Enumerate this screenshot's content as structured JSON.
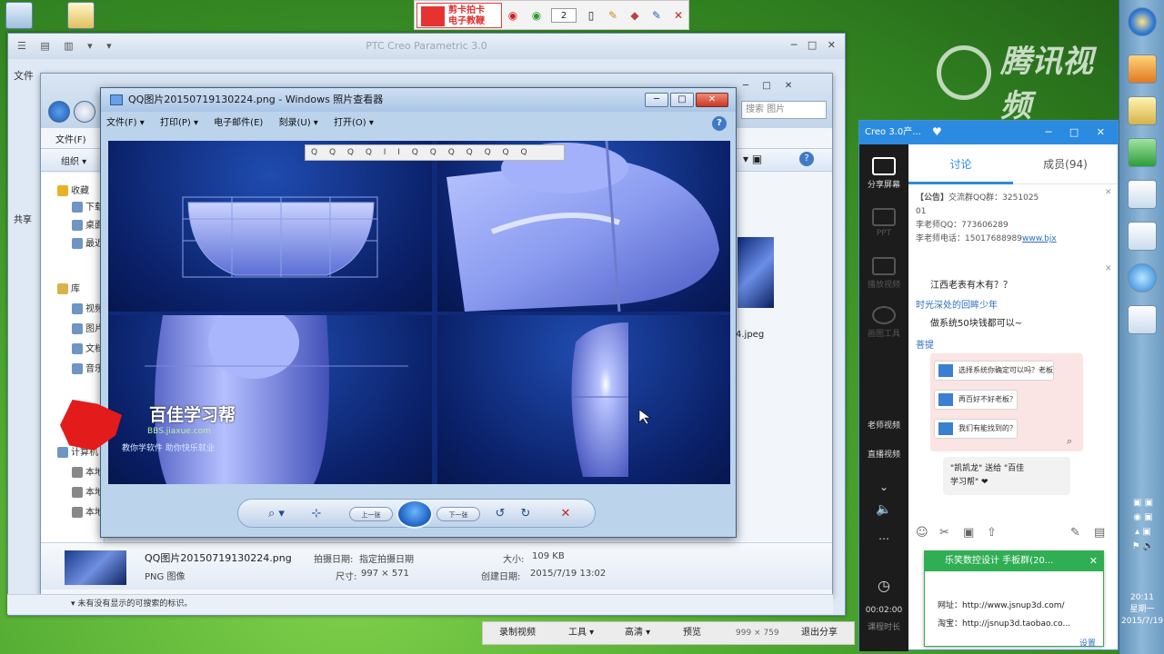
{
  "recorder": {
    "logo_line1": "剪卡拍卡",
    "logo_line2": "电子教鞭",
    "counter": "2",
    "bottom": {
      "record": "录制视频",
      "tools": "工具 ▾",
      "quality": "高清 ▾",
      "preview": "预览",
      "resolution": "999 × 759",
      "exit": "退出分享"
    }
  },
  "watermark": "腾讯视频",
  "back_window": {
    "title": "PTC Creo Parametric 3.0",
    "menu": "文件",
    "side": "共享"
  },
  "explorer": {
    "menu_file": "文件(F)",
    "organize": "组织 ▾",
    "search_placeholder": "搜索 图片",
    "side_items": [
      {
        "label": "收藏"
      },
      {
        "label": "下载"
      },
      {
        "label": "桌面"
      },
      {
        "label": "最近"
      },
      {
        "label": "库"
      },
      {
        "label": "视频"
      },
      {
        "label": "图片"
      },
      {
        "label": "文档"
      },
      {
        "label": "音乐"
      },
      {
        "label": "计算机"
      },
      {
        "label": "本地"
      },
      {
        "label": "本地"
      },
      {
        "label": "本地"
      }
    ],
    "file_tail": "4.jpeg",
    "details": {
      "name": "QQ图片20150719130224.png",
      "shot_label": "拍摄日期:",
      "shot_value": "指定拍摄日期",
      "type": "PNG 图像",
      "dims_label": "尺寸:",
      "dims_value": "997 × 571",
      "size_label": "大小:",
      "size_value": "109 KB",
      "created_label": "创建日期:",
      "created_value": "2015/7/19 13:02"
    },
    "status": "▾ 未有没有显示的可搜索的标识。"
  },
  "photo_viewer": {
    "title": "QQ图片20150719130224.png - Windows 照片查看器",
    "menu": [
      "文件(F) ▾",
      "打印(P) ▾",
      "电子邮件(E)",
      "刻录(U) ▾",
      "打开(O) ▾"
    ],
    "help": "?",
    "mini_toolbar": "Q Q Q Q I I Q Q Q Q Q Q Q",
    "zoom_btn": "⌕ ▾",
    "fit_btn": "⊹",
    "prev_btn": "上一张",
    "next_btn": "下一张",
    "rotate_left": "↺",
    "rotate_right": "↻",
    "delete": "✕"
  },
  "logo": {
    "name": "百佳学习帮",
    "url": "BBS.jiaxue.com",
    "slogan": "教你学软件  助你快乐就业"
  },
  "chat": {
    "header": "Creo 3.0产...",
    "side": {
      "share_screen": "分享屏幕",
      "ppt": "PPT",
      "play_video": "播放视频",
      "tool": "画图工具",
      "teacher_video": "老师视频",
      "live_video": "直播视频",
      "time": "00:02:00",
      "time_label": "课程时长"
    },
    "tab_discuss": "讨论",
    "tab_members": "成员(94)",
    "notice_title": "【公告】",
    "notice_lines": [
      "交流群QQ群：3251025",
      "01",
      "李老师QQ：773606289",
      "李老师电话：15017688989"
    ],
    "notice_link": "www.bjx",
    "messages": [
      {
        "text": "江西老表有木有？？"
      },
      {
        "name": "时光深处的回眸少年"
      },
      {
        "text": "做系统50块钱都可以~"
      },
      {
        "name": "菩提"
      }
    ],
    "bubbles": [
      "选择系统你确定可以吗？老板",
      "再百好不好老板？",
      "我们有能找到的？"
    ],
    "system_msg_line1": "\"凯凯龙\" 送给 \"百佳",
    "system_msg_line2": "学习帮\" ❤"
  },
  "popup": {
    "title": "乐笑数控设计 手板群(20...",
    "site_label": "网址：",
    "site": "http://www.jsnup3d.com/",
    "shop_label": "淘宝：",
    "shop": "http://jsnup3d.taobao.co...",
    "link": "设置"
  },
  "taskbar": {
    "time": "20:11",
    "weekday": "星期一",
    "date": "2015/7/19"
  }
}
